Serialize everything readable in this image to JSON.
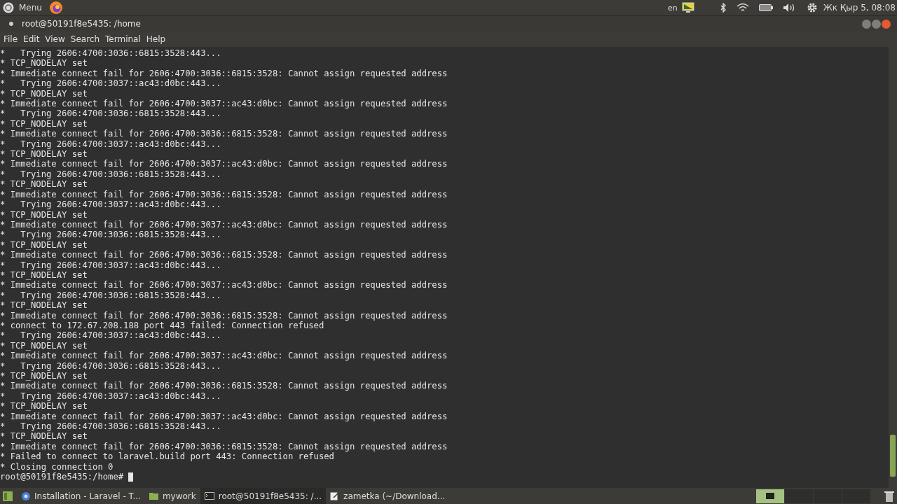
{
  "top_panel": {
    "menu_label": "Menu",
    "keyboard_layout": "en",
    "clock": "Жк Қыр  5, 08:08"
  },
  "window": {
    "title": "root@50191f8e5435: /home"
  },
  "menu_bar": [
    "File",
    "Edit",
    "View",
    "Search",
    "Terminal",
    "Help"
  ],
  "terminal": {
    "lines": [
      "*   Trying 2606:4700:3036::6815:3528:443...",
      "* TCP_NODELAY set",
      "* Immediate connect fail for 2606:4700:3036::6815:3528: Cannot assign requested address",
      "*   Trying 2606:4700:3037::ac43:d0bc:443...",
      "* TCP_NODELAY set",
      "* Immediate connect fail for 2606:4700:3037::ac43:d0bc: Cannot assign requested address",
      "*   Trying 2606:4700:3036::6815:3528:443...",
      "* TCP_NODELAY set",
      "* Immediate connect fail for 2606:4700:3036::6815:3528: Cannot assign requested address",
      "*   Trying 2606:4700:3037::ac43:d0bc:443...",
      "* TCP_NODELAY set",
      "* Immediate connect fail for 2606:4700:3037::ac43:d0bc: Cannot assign requested address",
      "*   Trying 2606:4700:3036::6815:3528:443...",
      "* TCP_NODELAY set",
      "* Immediate connect fail for 2606:4700:3036::6815:3528: Cannot assign requested address",
      "*   Trying 2606:4700:3037::ac43:d0bc:443...",
      "* TCP_NODELAY set",
      "* Immediate connect fail for 2606:4700:3037::ac43:d0bc: Cannot assign requested address",
      "*   Trying 2606:4700:3036::6815:3528:443...",
      "* TCP_NODELAY set",
      "* Immediate connect fail for 2606:4700:3036::6815:3528: Cannot assign requested address",
      "*   Trying 2606:4700:3037::ac43:d0bc:443...",
      "* TCP_NODELAY set",
      "* Immediate connect fail for 2606:4700:3037::ac43:d0bc: Cannot assign requested address",
      "*   Trying 2606:4700:3036::6815:3528:443...",
      "* TCP_NODELAY set",
      "* Immediate connect fail for 2606:4700:3036::6815:3528: Cannot assign requested address",
      "* connect to 172.67.208.188 port 443 failed: Connection refused",
      "*   Trying 2606:4700:3037::ac43:d0bc:443...",
      "* TCP_NODELAY set",
      "* Immediate connect fail for 2606:4700:3037::ac43:d0bc: Cannot assign requested address",
      "*   Trying 2606:4700:3036::6815:3528:443...",
      "* TCP_NODELAY set",
      "* Immediate connect fail for 2606:4700:3036::6815:3528: Cannot assign requested address",
      "*   Trying 2606:4700:3037::ac43:d0bc:443...",
      "* TCP_NODELAY set",
      "* Immediate connect fail for 2606:4700:3037::ac43:d0bc: Cannot assign requested address",
      "*   Trying 2606:4700:3036::6815:3528:443...",
      "* TCP_NODELAY set",
      "* Immediate connect fail for 2606:4700:3036::6815:3528: Cannot assign requested address",
      "* Failed to connect to laravel.build port 443: Connection refused",
      "* Closing connection 0"
    ],
    "prompt": "root@50191f8e5435:/home#"
  },
  "taskbar": {
    "items": [
      {
        "kind": "browser",
        "label": "Installation - Laravel - T...",
        "selected": false
      },
      {
        "kind": "folder",
        "label": "mywork",
        "selected": false
      },
      {
        "kind": "terminal",
        "label": "root@50191f8e5435: /...",
        "selected": true
      },
      {
        "kind": "editor",
        "label": "zametka (~/Download...",
        "selected": false
      }
    ]
  }
}
